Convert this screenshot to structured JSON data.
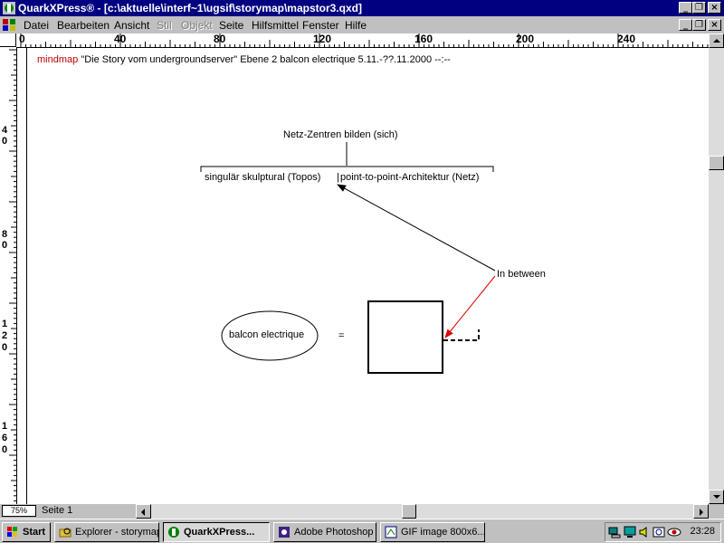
{
  "window": {
    "title": "QuarkXPress® - [c:\\aktuelle\\interf~1\\ugsif\\storymap\\mapstor3.qxd]"
  },
  "menu": {
    "items": [
      {
        "label": "Datei",
        "enabled": true
      },
      {
        "label": "Bearbeiten",
        "enabled": true
      },
      {
        "label": "Ansicht",
        "enabled": true
      },
      {
        "label": "Stil",
        "enabled": false
      },
      {
        "label": "Objekt",
        "enabled": false
      },
      {
        "label": "Seite",
        "enabled": true
      },
      {
        "label": "Hilfsmittel",
        "enabled": true
      },
      {
        "label": "Fenster",
        "enabled": true
      },
      {
        "label": "Hilfe",
        "enabled": true
      }
    ]
  },
  "ruler": {
    "top_labels": [
      "0",
      "40",
      "80",
      "120",
      "160",
      "200",
      "240"
    ],
    "left_labels": [
      [
        "4",
        "0"
      ],
      [
        "8",
        "0"
      ],
      [
        "1",
        "2",
        "0"
      ],
      [
        "1",
        "6",
        "0"
      ]
    ]
  },
  "document": {
    "header_keyword": "mindmap",
    "header_text": "\"Die Story vom undergroundserver\" Ebene 2 balcon electrique  5.11.-??.11.2000 --:--",
    "node_top": "Netz-Zentren bilden (sich)",
    "node_left": "singulär skulptural (Topos)",
    "node_right": "point-to-point-Architektur (Netz)",
    "node_between": "In between",
    "node_ellipse": "balcon electrique",
    "equals": "=",
    "colors": {
      "header_keyword": "#c00000",
      "arrow_red": "#e00000"
    }
  },
  "statusbar": {
    "zoom": "75%",
    "page": "Seite 1"
  },
  "taskbar": {
    "start": "Start",
    "tasks": [
      {
        "label": "Explorer - storymap",
        "active": false
      },
      {
        "label": "QuarkXPress...",
        "active": true
      },
      {
        "label": "Adobe Photoshop",
        "active": false
      },
      {
        "label": "GIF image 800x6...",
        "active": false
      }
    ],
    "clock": "23:28"
  }
}
